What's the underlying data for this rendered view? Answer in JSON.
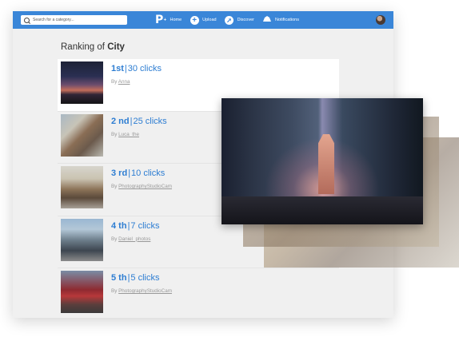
{
  "search": {
    "placeholder": "Search for a category..."
  },
  "nav": {
    "logo": "P",
    "items": [
      {
        "label": "Home",
        "icon": "logo-icon"
      },
      {
        "label": "Upload",
        "icon": "plus-icon"
      },
      {
        "label": "Discover",
        "icon": "compass-icon"
      },
      {
        "label": "Notifications",
        "icon": "bell-icon"
      }
    ]
  },
  "page": {
    "heading_prefix": "Ranking of",
    "category": "City"
  },
  "ranking": [
    {
      "place": "1st",
      "clicks": "30 clicks",
      "by": "By",
      "author": "Anna"
    },
    {
      "place": "2 nd",
      "clicks": "25 clicks",
      "by": "By",
      "author": "Luca_the"
    },
    {
      "place": "3 rd",
      "clicks": "10 clicks",
      "by": "By",
      "author": "PhotographyStudioCam"
    },
    {
      "place": "4 th",
      "clicks": "7 clicks",
      "by": "By",
      "author": "Daniel_photos"
    },
    {
      "place": "5 th",
      "clicks": "5 clicks",
      "by": "By",
      "author": "PhotographyStudioCam"
    }
  ],
  "colors": {
    "topbar": "#3a86d8",
    "accent": "#2d7dd2"
  }
}
